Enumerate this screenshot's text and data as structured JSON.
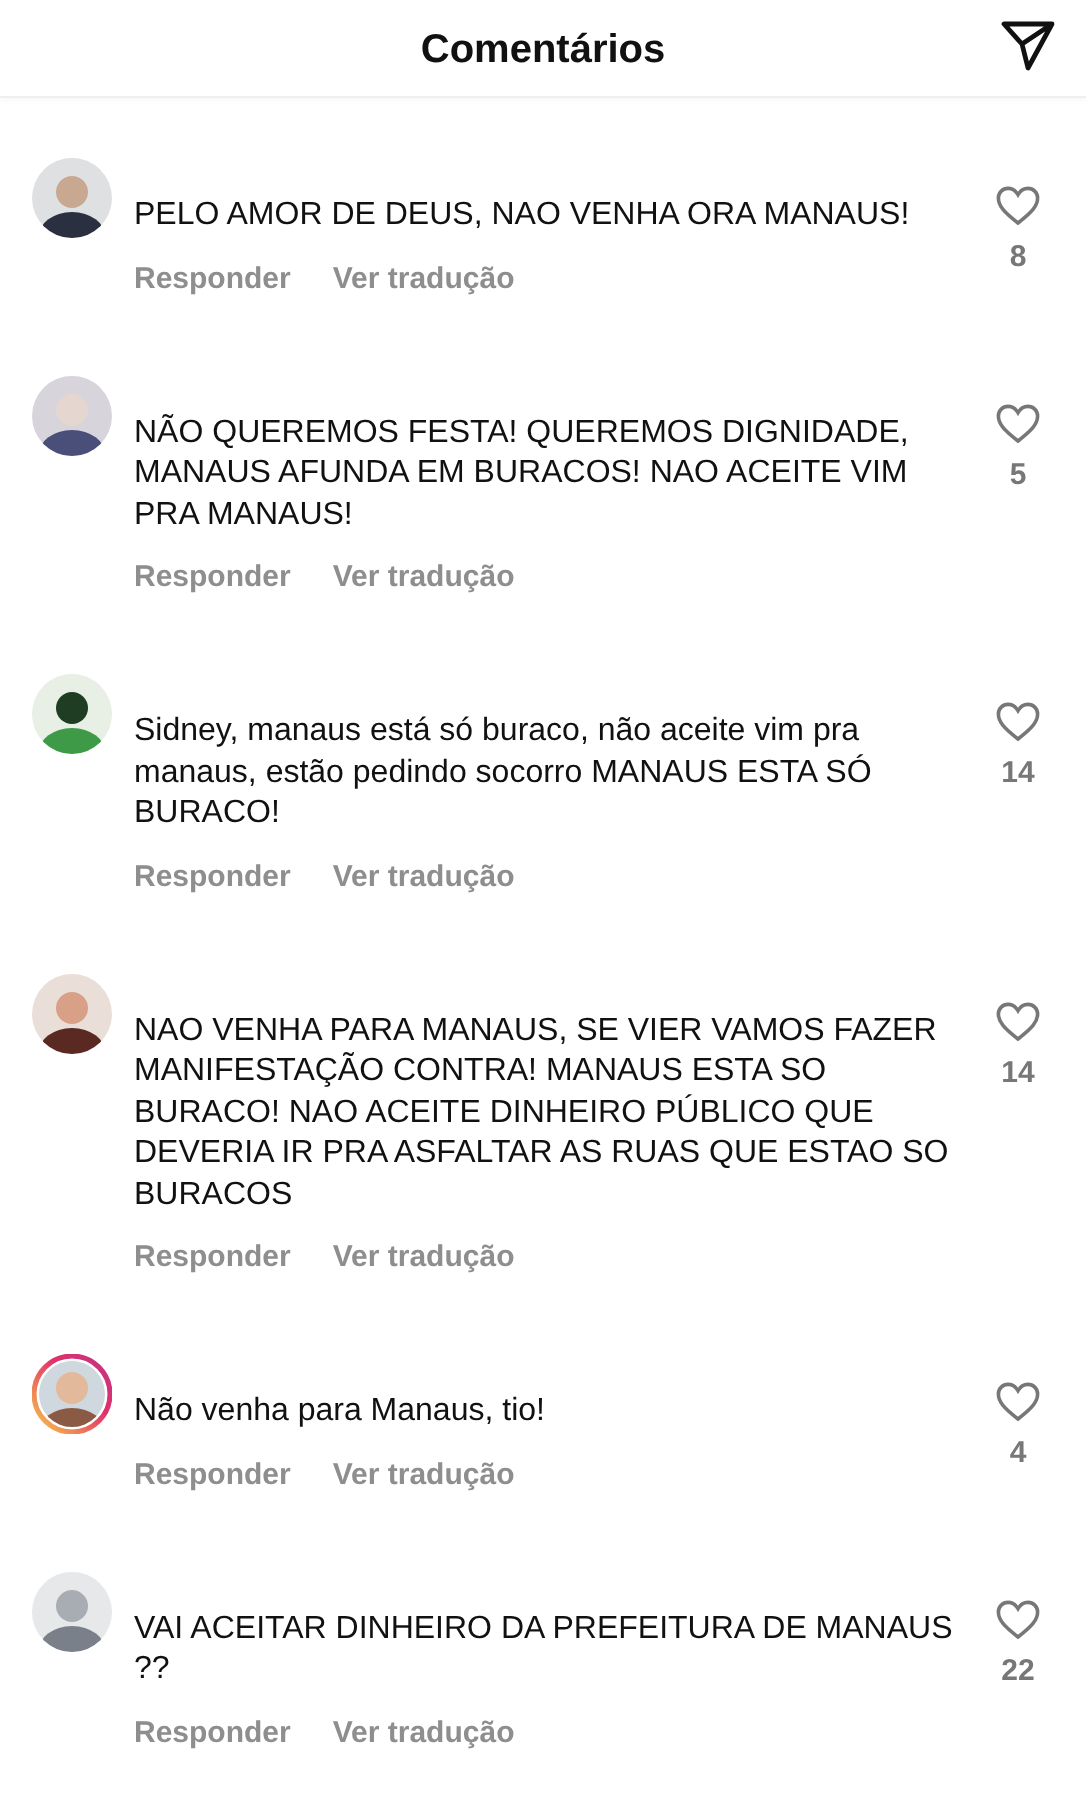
{
  "header": {
    "title": "Comentários"
  },
  "comments": [
    {
      "text": "PELO AMOR DE DEUS, NAO VENHA ORA MANAUS!",
      "reply": "Responder",
      "translate": "Ver tradução",
      "likes": "8",
      "story_ring": false
    },
    {
      "text": "NÃO QUEREMOS FESTA! QUEREMOS DIGNIDADE,  MANAUS AFUNDA EM BURACOS! NAO ACEITE VIM PRA MANAUS!",
      "reply": "Responder",
      "translate": "Ver tradução",
      "likes": "5",
      "story_ring": false
    },
    {
      "text": "Sidney, manaus está só buraco, não aceite vim pra manaus, estão pedindo socorro MANAUS ESTA SÓ BURACO!",
      "reply": "Responder",
      "translate": "Ver tradução",
      "likes": "14",
      "story_ring": false
    },
    {
      "text": "NAO VENHA PARA MANAUS, SE VIER VAMOS FAZER MANIFESTAÇÃO CONTRA! MANAUS ESTA SO BURACO! NAO ACEITE DINHEIRO PÚBLICO QUE DEVERIA IR PRA ASFALTAR AS RUAS QUE ESTAO SO BURACOS",
      "reply": "Responder",
      "translate": "Ver tradução",
      "likes": "14",
      "story_ring": false
    },
    {
      "text": "Não venha para Manaus, tio!",
      "reply": "Responder",
      "translate": "Ver tradução",
      "likes": "4",
      "story_ring": true
    },
    {
      "text": "VAI ACEITAR DINHEIRO DA PREFEITURA DE MANAUS ??",
      "reply": "Responder",
      "translate": "Ver tradução",
      "likes": "22",
      "story_ring": false
    }
  ]
}
